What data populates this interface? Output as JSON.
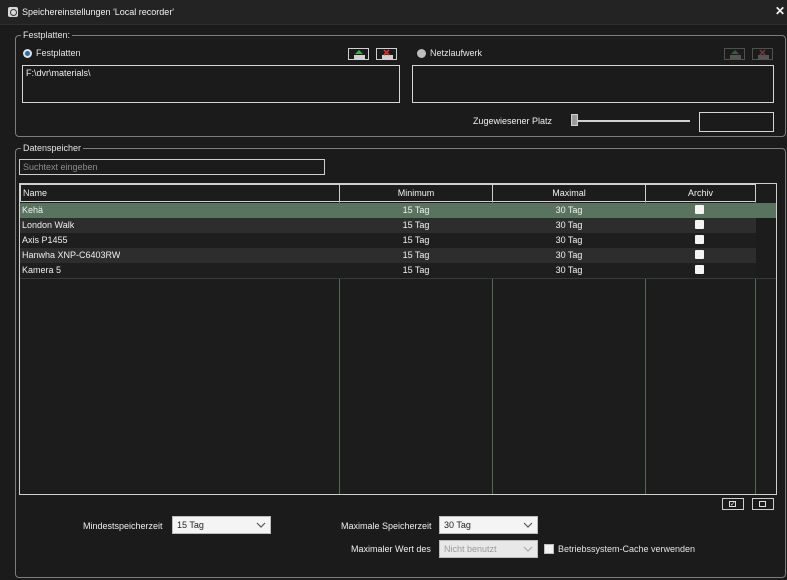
{
  "window": {
    "title": "Speichereinstellungen 'Local recorder'"
  },
  "storage_group": {
    "legend": "Festplatten:",
    "local_radio_label": "Festplatten",
    "network_radio_label": "Netzlaufwerk",
    "local_path": "F:\\dvr\\materials\\",
    "network_path": "",
    "assigned_space_label": "Zugewiesener Platz",
    "assigned_space_value": ""
  },
  "datastore_group": {
    "legend": "Datenspeicher",
    "search_placeholder": "Suchtext eingeben",
    "columns": [
      "Name",
      "Minimum",
      "Maximal",
      "Archiv"
    ],
    "rows": [
      {
        "name": "Kehä",
        "min": "15 Tag",
        "max": "30 Tag",
        "archive": false,
        "selected": true
      },
      {
        "name": "London Walk",
        "min": "15 Tag",
        "max": "30 Tag",
        "archive": false,
        "selected": false
      },
      {
        "name": "Axis P1455",
        "min": "15 Tag",
        "max": "30 Tag",
        "archive": false,
        "selected": false
      },
      {
        "name": "Hanwha XNP-C6403RW",
        "min": "15 Tag",
        "max": "30 Tag",
        "archive": false,
        "selected": false
      },
      {
        "name": "Kamera 5",
        "min": "15 Tag",
        "max": "30 Tag",
        "archive": false,
        "selected": false
      }
    ]
  },
  "settings": {
    "min_storage_label": "Mindestspeicherzeit",
    "min_storage_value": "15 Tag",
    "max_storage_label": "Maximale Speicherzeit",
    "max_storage_value": "30 Tag",
    "max_value_label": "Maximaler Wert des",
    "max_value_value": "Nicht benutzt",
    "os_cache_label": "Betriebssystem-Cache verwenden"
  },
  "colors": {
    "selected_row": "#59735f",
    "row_dark": "#2d2d2d",
    "row_darker": "#1e1e1e",
    "grid_line": "#4f6a55",
    "radio_checked": "#2c6db0"
  }
}
